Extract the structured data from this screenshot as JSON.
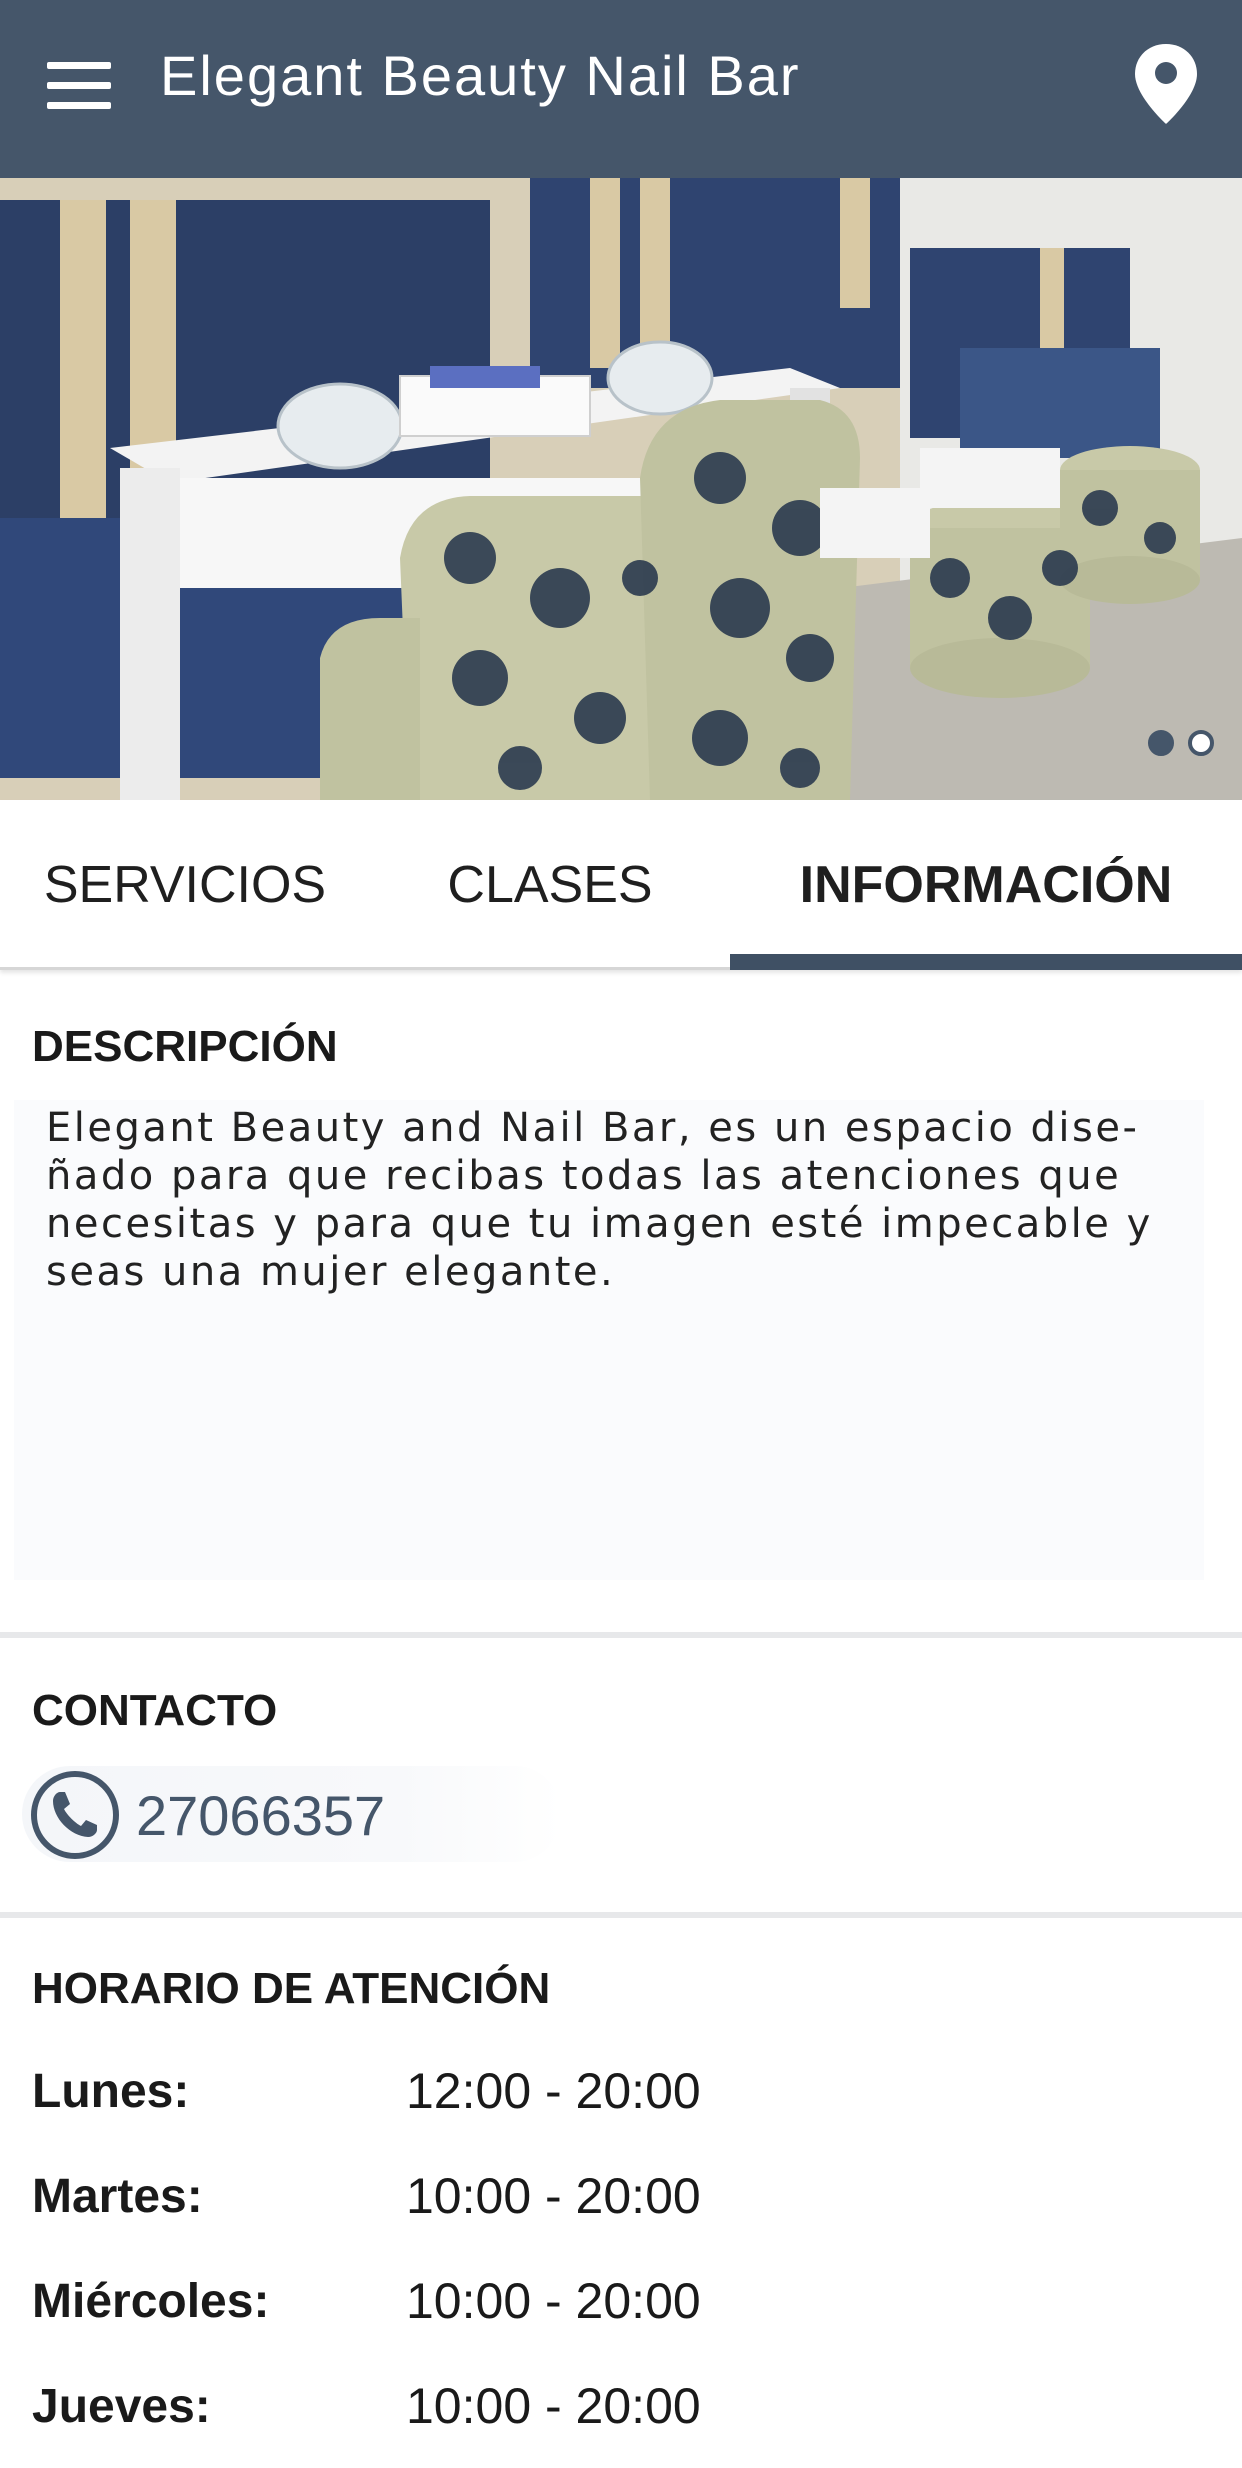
{
  "app_bar": {
    "title": "Elegant Beauty Nail Bar",
    "menu_icon": "hamburger-menu-icon",
    "location_icon": "map-pin-icon",
    "background": "#45566a"
  },
  "carousel": {
    "slide_count": 2,
    "active_index": 0
  },
  "tabs": [
    {
      "label": "SERVICIOS",
      "active": false
    },
    {
      "label": "CLASES",
      "active": false
    },
    {
      "label": "INFORMACIÓN",
      "active": true
    }
  ],
  "description": {
    "title": "DESCRIPCIÓN",
    "lines": [
      "Elegant Beauty and Nail Bar, es un espacio dise-",
      "ñado para que recibas todas las atenciones que",
      "necesitas y para que tu imagen esté impecable y",
      "seas una mujer elegante."
    ]
  },
  "contact": {
    "title": "CONTACTO",
    "phone": "27066357",
    "phone_icon": "phone-icon"
  },
  "hours": {
    "title": "HORARIO DE ATENCIÓN",
    "rows": [
      {
        "day": "Lunes:",
        "time": "12:00 - 20:00"
      },
      {
        "day": "Martes:",
        "time": "10:00 - 20:00"
      },
      {
        "day": "Miércoles:",
        "time": "10:00 - 20:00"
      },
      {
        "day": "Jueves:",
        "time": "10:00 - 20:00"
      }
    ]
  },
  "colors": {
    "primary": "#45566a",
    "tab_indicator": "#3f5064"
  }
}
